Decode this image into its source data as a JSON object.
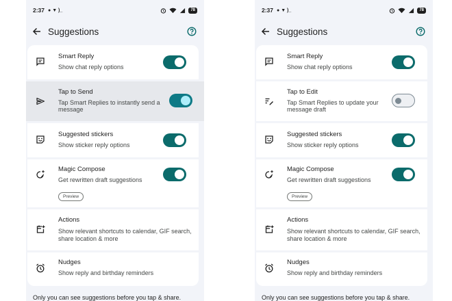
{
  "status_bar": {
    "time": "2:37",
    "battery": "78"
  },
  "screen_title": "Suggestions",
  "colors": {
    "toggle_on": "#0b6b6b",
    "toggle_off": "#7d8a93",
    "background": "#f2f4f9"
  },
  "left": {
    "rows": [
      {
        "icon": "chat-bubble-icon",
        "title": "Smart Reply",
        "subtitle": "Show chat reply options",
        "toggle": "on"
      },
      {
        "icon": "send-icon",
        "title": "Tap to Send",
        "subtitle": "Tap Smart Replies to instantly send a message",
        "toggle": "on"
      },
      {
        "icon": "sticker-icon",
        "title": "Suggested stickers",
        "subtitle": "Show sticker reply options",
        "toggle": "on"
      },
      {
        "icon": "magic-compose-icon",
        "title": "Magic Compose",
        "subtitle": "Get rewritten draft suggestions",
        "toggle": "on",
        "chip": "Preview"
      },
      {
        "icon": "calendar-add-icon",
        "title": "Actions",
        "subtitle": "Show relevant shortcuts to calendar, GIF search, share location & more"
      },
      {
        "icon": "alarm-icon",
        "title": "Nudges",
        "subtitle": "Show reply and birthday reminders"
      }
    ],
    "footer": "Only you can see suggestions before you tap & share."
  },
  "right": {
    "rows": [
      {
        "icon": "chat-bubble-icon",
        "title": "Smart Reply",
        "subtitle": "Show chat reply options",
        "toggle": "on"
      },
      {
        "icon": "edit-text-icon",
        "title": "Tap to Edit",
        "subtitle": "Tap Smart Replies to update your message draft",
        "toggle": "off"
      },
      {
        "icon": "sticker-icon",
        "title": "Suggested stickers",
        "subtitle": "Show sticker reply options",
        "toggle": "on"
      },
      {
        "icon": "magic-compose-icon",
        "title": "Magic Compose",
        "subtitle": "Get rewritten draft suggestions",
        "toggle": "on",
        "chip": "Preview"
      },
      {
        "icon": "calendar-add-icon",
        "title": "Actions",
        "subtitle": "Show relevant shortcuts to calendar, GIF search, share location & more"
      },
      {
        "icon": "alarm-icon",
        "title": "Nudges",
        "subtitle": "Show reply and birthday reminders"
      }
    ],
    "footer": "Only you can see suggestions before you tap & share."
  }
}
